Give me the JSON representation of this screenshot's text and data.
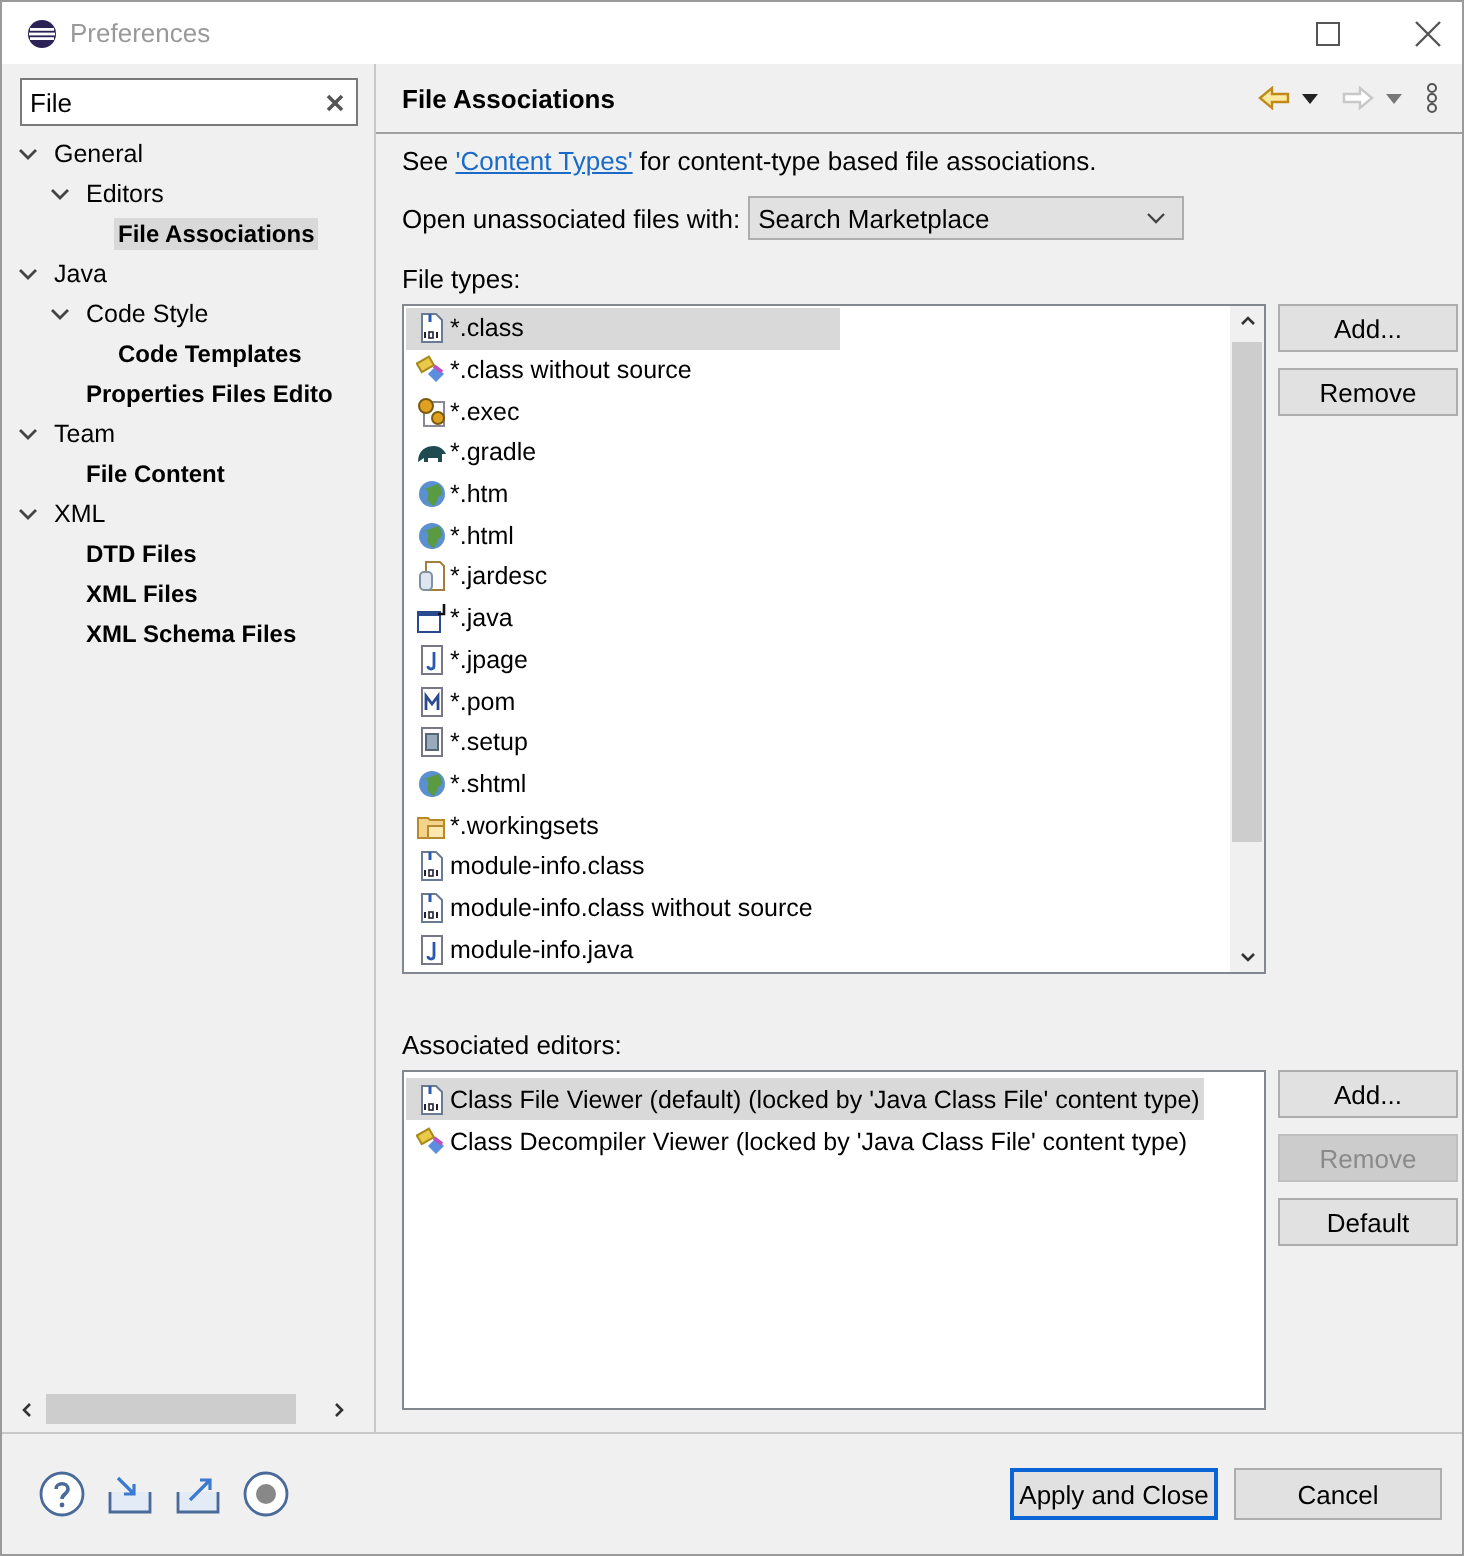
{
  "window": {
    "title": "Preferences"
  },
  "sidebar": {
    "filter": {
      "value": "File"
    },
    "tree": [
      {
        "label": "General",
        "matched": false,
        "selected": false,
        "expanded": true,
        "children": [
          {
            "label": "Editors",
            "matched": false,
            "selected": false,
            "expanded": true,
            "children": [
              {
                "label": "File Associations",
                "matched": true,
                "selected": true
              }
            ]
          }
        ]
      },
      {
        "label": "Java",
        "matched": false,
        "selected": false,
        "expanded": true,
        "children": [
          {
            "label": "Code Style",
            "matched": false,
            "selected": false,
            "expanded": true,
            "children": [
              {
                "label": "Code Templates",
                "matched": true,
                "selected": false
              }
            ]
          },
          {
            "label": "Properties Files Edito",
            "matched": true,
            "selected": false
          }
        ]
      },
      {
        "label": "Team",
        "matched": false,
        "selected": false,
        "expanded": true,
        "children": [
          {
            "label": "File Content",
            "matched": true,
            "selected": false
          }
        ]
      },
      {
        "label": "XML",
        "matched": false,
        "selected": false,
        "expanded": true,
        "children": [
          {
            "label": "DTD Files",
            "matched": true,
            "selected": false
          },
          {
            "label": "XML Files",
            "matched": true,
            "selected": false
          },
          {
            "label": "XML Schema Files",
            "matched": true,
            "selected": false
          }
        ]
      }
    ]
  },
  "page": {
    "title": "File Associations",
    "navigation": [
      {
        "kind": "back",
        "disabled": false
      },
      {
        "kind": "forward",
        "disabled": true
      }
    ],
    "intro": {
      "before": "See ",
      "link": "'Content Types'",
      "after": " for content-type based file associations."
    },
    "open_with": {
      "label": "Open unassociated files with:",
      "value": "Search Marketplace"
    },
    "file_types": {
      "label": "File types:",
      "items": [
        {
          "name": "*.class",
          "kind": "binary",
          "selected": true
        },
        {
          "name": "*.class without source",
          "kind": "decompiler",
          "selected": false
        },
        {
          "name": "*.exec",
          "kind": "gears",
          "selected": false
        },
        {
          "name": "*.gradle",
          "kind": "elephant",
          "selected": false
        },
        {
          "name": "*.htm",
          "kind": "globe",
          "selected": false
        },
        {
          "name": "*.html",
          "kind": "globe",
          "selected": false
        },
        {
          "name": "*.jardesc",
          "kind": "jar",
          "selected": false
        },
        {
          "name": "*.java",
          "kind": "java",
          "selected": false
        },
        {
          "name": "*.jpage",
          "kind": "jfile",
          "selected": false
        },
        {
          "name": "*.pom",
          "kind": "mfile",
          "selected": false
        },
        {
          "name": "*.setup",
          "kind": "setup",
          "selected": false
        },
        {
          "name": "*.shtml",
          "kind": "globe",
          "selected": false
        },
        {
          "name": "*.workingsets",
          "kind": "folder",
          "selected": false
        },
        {
          "name": "module-info.class",
          "kind": "binary",
          "selected": false
        },
        {
          "name": "module-info.class without source",
          "kind": "binary",
          "selected": false
        },
        {
          "name": "module-info.java",
          "kind": "jfile",
          "selected": false
        }
      ],
      "buttons": [
        {
          "label": "Add...",
          "disabled": false
        },
        {
          "label": "Remove",
          "disabled": false
        }
      ]
    },
    "associated_editors": {
      "label": "Associated editors:",
      "items": [
        {
          "name": "Class File Viewer (default) (locked by 'Java Class File' content type)",
          "kind": "binary",
          "selected": true
        },
        {
          "name": "Class Decompiler Viewer (locked by 'Java Class File' content type)",
          "kind": "decompiler",
          "selected": false
        }
      ],
      "buttons": [
        {
          "label": "Add...",
          "disabled": false
        },
        {
          "label": "Remove",
          "disabled": true
        },
        {
          "label": "Default",
          "disabled": false
        }
      ]
    }
  },
  "footer": {
    "buttons": [
      {
        "label": "Apply and Close",
        "default": true
      },
      {
        "label": "Cancel",
        "default": false
      }
    ]
  }
}
